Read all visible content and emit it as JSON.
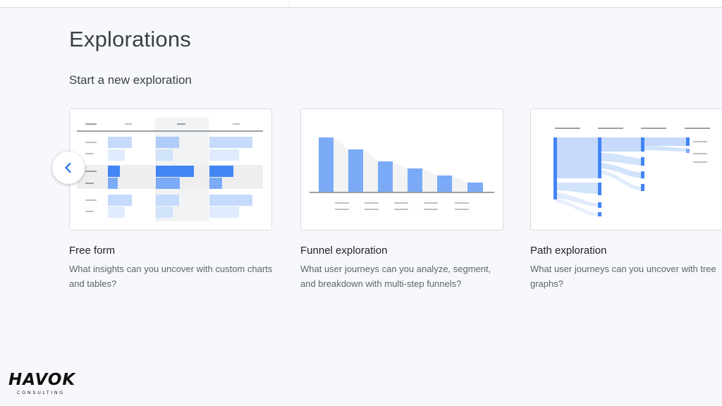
{
  "page": {
    "title": "Explorations",
    "section_title": "Start a new exploration"
  },
  "templates": [
    {
      "title": "Free form",
      "description": "What insights can you uncover with custom charts and tables?"
    },
    {
      "title": "Funnel exploration",
      "description": "What user journeys can you analyze, segment, and breakdown with multi-step funnels?"
    },
    {
      "title": "Path exploration",
      "description": "What user journeys can you uncover with tree graphs?"
    }
  ],
  "carousel": {
    "prev_icon": "chevron-left-icon"
  },
  "logo": {
    "word": "HAVOK",
    "sub": "CONSULTING"
  },
  "colors": {
    "accent": "#4285f4",
    "accent_mid": "#7baaf7",
    "accent_light": "#c6dafc",
    "accent_pale": "#e0ebfd",
    "bar_gray": "#dadce0",
    "background": "#f6f8fc"
  }
}
